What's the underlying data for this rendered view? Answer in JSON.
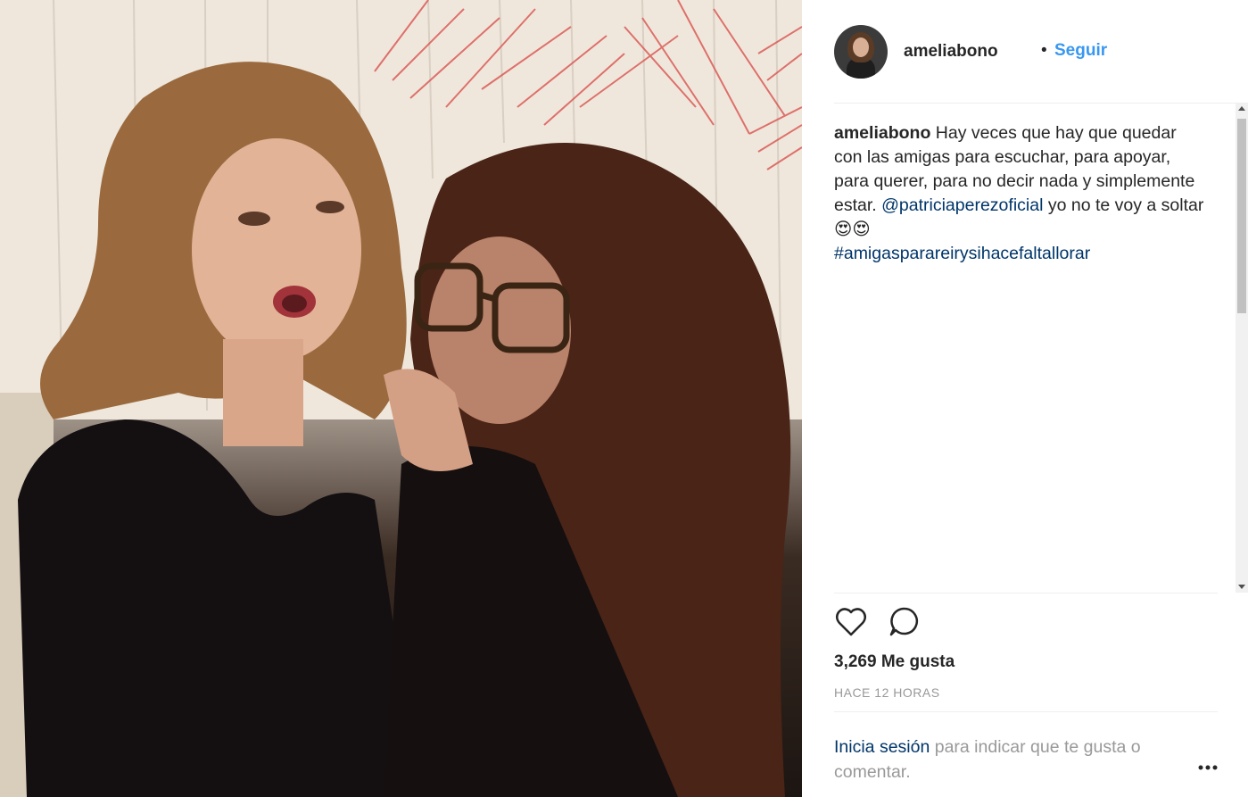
{
  "post": {
    "username": "ameliabono",
    "follow_label": "Seguir",
    "separator": "•",
    "caption": {
      "username": "ameliabono",
      "text_before": "Hay veces que hay que quedar con las amigas para escuchar, para apoyar, para querer, para no decir nada y simplemente estar.",
      "mention": "@patriciaperezoficial",
      "text_after": "yo no te voy a soltar 😍😍",
      "hashtag": "#amigasparareirysihacefaltallorar"
    },
    "likes": "3,269 Me gusta",
    "timestamp": "HACE 12 HORAS",
    "login_prompt": {
      "link": "Inicia sesión",
      "text": "para indicar que te gusta o comentar."
    }
  },
  "icons": {
    "like": "heart-icon",
    "comment": "comment-icon",
    "more": "more-options-icon"
  },
  "colors": {
    "link": "#3897f0",
    "hashtag": "#003569",
    "muted": "#999999",
    "text": "#262626"
  }
}
